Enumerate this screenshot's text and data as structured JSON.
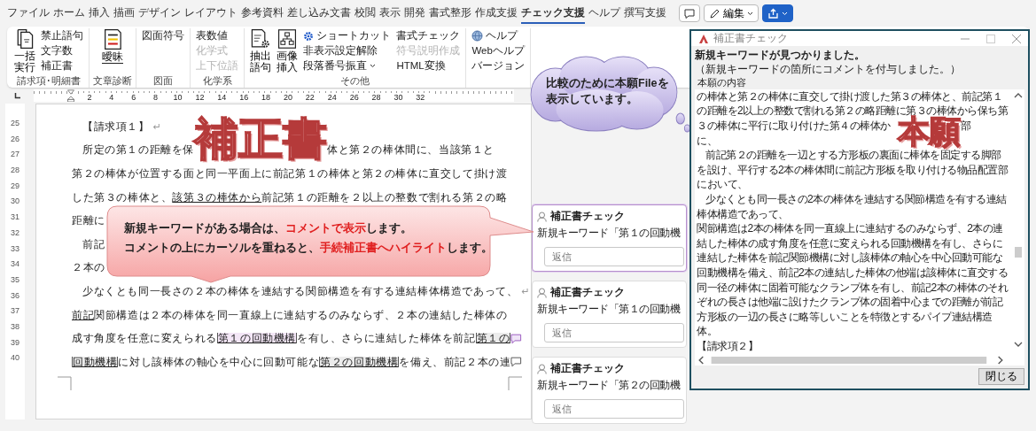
{
  "menu": {
    "tabs": [
      {
        "label": "ファイル",
        "selected": false
      },
      {
        "label": "ホーム",
        "selected": false
      },
      {
        "label": "挿入",
        "selected": false
      },
      {
        "label": "描画",
        "selected": false
      },
      {
        "label": "デザイン",
        "selected": false
      },
      {
        "label": "レイアウト",
        "selected": false
      },
      {
        "label": "参考資料",
        "selected": false
      },
      {
        "label": "差し込み文書",
        "selected": false
      },
      {
        "label": "校閲",
        "selected": false
      },
      {
        "label": "表示",
        "selected": false
      },
      {
        "label": "開発",
        "selected": false
      },
      {
        "label": "書式整形",
        "selected": false
      },
      {
        "label": "作成支援",
        "selected": false
      },
      {
        "label": "チェック支援",
        "selected": true
      },
      {
        "label": "ヘルプ",
        "selected": false
      },
      {
        "label": "撰写支援",
        "selected": false
      }
    ],
    "edit_button": "編集"
  },
  "ribbon": {
    "groups": [
      {
        "label": "請求項･明細書",
        "columns": [
          [
            {
              "label": "一括実行",
              "kind": "large",
              "disabled": false,
              "dropdown": false
            }
          ],
          [
            {
              "label": "禁止語句",
              "kind": "small",
              "disabled": false,
              "dropdown": false
            },
            {
              "label": "文字数",
              "kind": "small",
              "disabled": false,
              "dropdown": false
            },
            {
              "label": "補正書",
              "kind": "small",
              "disabled": false,
              "dropdown": false
            }
          ]
        ]
      },
      {
        "label": "文章診断",
        "columns": [
          [
            {
              "label": "曖昧",
              "kind": "large",
              "disabled": false,
              "dropdown": false
            }
          ]
        ]
      },
      {
        "label": "図面",
        "columns": [
          [
            {
              "label": "図面符号",
              "kind": "small",
              "disabled": false,
              "dropdown": false
            }
          ]
        ]
      },
      {
        "label": "化学系",
        "columns": [
          [
            {
              "label": "表数値",
              "kind": "small",
              "disabled": false,
              "dropdown": false
            },
            {
              "label": "化学式",
              "kind": "small",
              "disabled": true,
              "dropdown": false
            },
            {
              "label": "上下位語",
              "kind": "small",
              "disabled": true,
              "dropdown": false
            }
          ]
        ]
      },
      {
        "label": "その他",
        "columns": [
          [
            {
              "label": "抽出語句",
              "kind": "large",
              "disabled": false,
              "dropdown": false
            }
          ],
          [
            {
              "label": "画像挿入",
              "kind": "large",
              "disabled": false,
              "dropdown": false
            }
          ],
          [
            {
              "label": "ショートカット",
              "kind": "small",
              "disabled": false,
              "dropdown": false
            },
            {
              "label": "非表示設定解除",
              "kind": "small",
              "disabled": false,
              "dropdown": false
            },
            {
              "label": "段落番号振直",
              "kind": "small",
              "disabled": false,
              "dropdown": true
            }
          ],
          [
            {
              "label": "書式チェック",
              "kind": "small",
              "disabled": false,
              "dropdown": false
            },
            {
              "label": "符号説明作成",
              "kind": "small",
              "disabled": true,
              "dropdown": false
            },
            {
              "label": "HTML変換",
              "kind": "small",
              "disabled": false,
              "dropdown": false
            }
          ]
        ]
      },
      {
        "columns": [
          [
            {
              "label": "ヘルプ",
              "kind": "small",
              "disabled": false,
              "dropdown": false
            },
            {
              "label": "Webヘルプ",
              "kind": "small",
              "disabled": false,
              "dropdown": false
            },
            {
              "label": "バージョン",
              "kind": "small",
              "disabled": false,
              "dropdown": false
            }
          ]
        ]
      }
    ]
  },
  "ruler": {
    "numbers": [
      "2",
      "4",
      "6",
      "8",
      "10",
      "12",
      "14",
      "16",
      "18",
      "20",
      "22",
      "24",
      "26",
      "28",
      "30",
      "32"
    ]
  },
  "vertical_ruler": {
    "numbers": [
      "25",
      "26",
      "27",
      "28",
      "29",
      "30",
      "31",
      "32",
      "33",
      "34",
      "35",
      "36",
      "37",
      "38",
      "39",
      "40"
    ]
  },
  "document": {
    "lines": [
      {
        "indent": true,
        "segments": [
          {
            "text": "【請求項１】",
            "kind": "plain"
          }
        ],
        "return_mark": "↵"
      },
      {
        "indent": true,
        "segments": [
          {
            "text": "所定の第１の距離を保",
            "kind": "plain"
          },
          {
            "text": "補正書",
            "kind": "stamp"
          },
          {
            "text": "体と第２の棒体間に、当該第１と",
            "kind": "plain"
          }
        ]
      },
      {
        "indent": false,
        "segments": [
          {
            "text": "第２の棒体が位置する面と同一平面上に前記第１の棒体と第２の棒体に直交して掛け渡",
            "kind": "plain"
          }
        ]
      },
      {
        "indent": false,
        "segments": [
          {
            "text": "した第３の棒体と、",
            "kind": "plain"
          },
          {
            "text": "該第３の棒体から",
            "kind": "underline"
          },
          {
            "text": "前記第１の距離を２以上の整数で割れる第２の略",
            "kind": "plain"
          }
        ]
      },
      {
        "indent": false,
        "segments": [
          {
            "text": "距離に",
            "kind": "plain"
          }
        ]
      },
      {
        "indent": true,
        "segments": [
          {
            "text": "前記",
            "kind": "plain"
          }
        ]
      },
      {
        "indent": false,
        "segments": [
          {
            "text": "２本の",
            "kind": "plain"
          }
        ]
      },
      {
        "indent": true,
        "segments": [
          {
            "text": "少なくとも同一長さの２本の棒体を連結する関節構造を有する連結棒体構造であって、",
            "kind": "plain"
          }
        ],
        "return_mark": "↵"
      },
      {
        "indent": false,
        "segments": [
          {
            "text": "前記",
            "kind": "underline"
          },
          {
            "text": "関節構造は２本の棒体を同一直線上に連結するのみならず、２本の連結した棒体の",
            "kind": "plain"
          }
        ]
      },
      {
        "indent": false,
        "segments": [
          {
            "text": "成す角度を任意に変えられる",
            "kind": "plain"
          },
          {
            "text": "第１の回動機構",
            "kind": "keyword_active"
          },
          {
            "text": "を有し、さらに連結した棒体を前記",
            "kind": "plain"
          },
          {
            "text": "第１の",
            "kind": "keyword"
          }
        ],
        "comment": {
          "active": true
        }
      },
      {
        "indent": false,
        "segments": [
          {
            "text": "回動機構",
            "kind": "keyword"
          },
          {
            "text": "に対し該棒体の軸心を中心に回動可能な",
            "kind": "plain"
          },
          {
            "text": "第２の回動機構",
            "kind": "keyword"
          },
          {
            "text": "を備え、前記２本の連",
            "kind": "plain"
          }
        ],
        "comment": {
          "active": false
        }
      }
    ]
  },
  "cloud": {
    "lines": [
      "比較のために本願Fileを",
      "表示しています。"
    ]
  },
  "callout": {
    "lines": [
      [
        {
          "text": "新規キーワードがある場合は、",
          "emphasis": false
        },
        {
          "text": "コメントで表示",
          "emphasis": true
        },
        {
          "text": "します。",
          "emphasis": false
        }
      ],
      [
        {
          "text": "コメントの上にカーソルを重ねると、",
          "emphasis": false
        },
        {
          "text": "手続補正書へハイライト",
          "emphasis": true
        },
        {
          "text": "します。",
          "emphasis": false
        }
      ]
    ]
  },
  "comments": [
    {
      "author": "補正書チェック",
      "text": "新規キーワード「第１の回動機",
      "reply_placeholder": "返信",
      "selected": true
    },
    {
      "author": "補正書チェック",
      "text": "新規キーワード「第１の回動機",
      "reply_placeholder": "返信",
      "selected": false
    },
    {
      "author": "補正書チェック",
      "text": "新規キーワード「第２の回動機",
      "reply_placeholder": "返信",
      "selected": false
    }
  ],
  "dialog": {
    "title": "補正書チェック",
    "message": "新規キーワードが見つかりました。",
    "note": "（新規キーワードの箇所にコメントを付与しました。）",
    "content_label": "本願の内容",
    "lines": [
      {
        "indent": false,
        "segments": [
          {
            "text": "の棒体と第２の棒体に直交して掛け渡した第３の棒体と、前記第１",
            "kind": "plain"
          }
        ]
      },
      {
        "indent": false,
        "segments": [
          {
            "text": "の距離を2以上の整数で割れる第２の略距離に第３の棒体から保ち第",
            "kind": "plain"
          }
        ]
      },
      {
        "indent": false,
        "segments": [
          {
            "text": "３の棒体に平行に取り付けた第４の棒体か",
            "kind": "plain"
          },
          {
            "text": "本願",
            "kind": "stamp"
          },
          {
            "text": "部",
            "kind": "plain"
          }
        ]
      },
      {
        "indent": false,
        "segments": [
          {
            "text": "に、",
            "kind": "plain"
          }
        ]
      },
      {
        "indent": true,
        "segments": [
          {
            "text": "前記第２の距離を一辺とする方形板の裏面に棒体を固定する脚部",
            "kind": "plain"
          }
        ]
      },
      {
        "indent": false,
        "segments": [
          {
            "text": "を設け、平行する2本の棒体間に前記方形板を取り付ける物品配置部",
            "kind": "plain"
          }
        ]
      },
      {
        "indent": false,
        "segments": [
          {
            "text": "において、",
            "kind": "plain"
          }
        ]
      },
      {
        "indent": true,
        "segments": [
          {
            "text": "少なくとも同一長さの2本の棒体を連結する関節構造を有する連結",
            "kind": "plain"
          }
        ]
      },
      {
        "indent": false,
        "segments": [
          {
            "text": "棒体構造であって、",
            "kind": "plain"
          }
        ]
      },
      {
        "indent": false,
        "segments": [
          {
            "text": "関節構造は2本の棒体を同一直線上に連結するのみならず、2本の連",
            "kind": "plain"
          }
        ]
      },
      {
        "indent": false,
        "segments": [
          {
            "text": "結した棒体の成す角度を任意に変えられる回動機構を有し、さらに",
            "kind": "plain"
          }
        ]
      },
      {
        "indent": false,
        "segments": [
          {
            "text": "連結した棒体を前記関節機構に対し該棒体の軸心を中心回動可能な",
            "kind": "plain"
          }
        ]
      },
      {
        "indent": false,
        "segments": [
          {
            "text": "回動機構を備え、前記2本の連結した棒体の他端は該棒体に直交する",
            "kind": "plain"
          }
        ]
      },
      {
        "indent": false,
        "segments": [
          {
            "text": "同一径の棒体に固着可能なクランプ体を有し、前記2本の棒体のそれ",
            "kind": "plain"
          }
        ]
      },
      {
        "indent": false,
        "segments": [
          {
            "text": "ぞれの長さは他端に設けたクランプ体の固着中心までの距離が前記",
            "kind": "plain"
          }
        ]
      },
      {
        "indent": false,
        "segments": [
          {
            "text": "方形板の一辺の長さに略等しいことを特徴とするパイプ連結構造",
            "kind": "plain"
          }
        ]
      },
      {
        "indent": false,
        "segments": [
          {
            "text": "体。",
            "kind": "plain"
          }
        ]
      },
      {
        "indent": false,
        "segments": [
          {
            "text": "【請求項２】",
            "kind": "plain"
          }
        ]
      }
    ],
    "close_button": "閉じる"
  }
}
